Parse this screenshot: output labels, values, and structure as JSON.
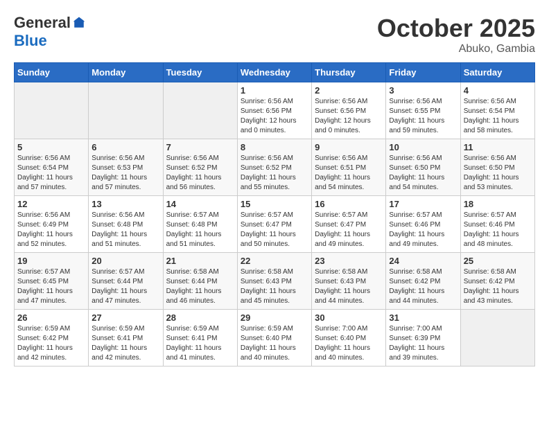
{
  "logo": {
    "general": "General",
    "blue": "Blue"
  },
  "title": "October 2025",
  "location": "Abuko, Gambia",
  "days_header": [
    "Sunday",
    "Monday",
    "Tuesday",
    "Wednesday",
    "Thursday",
    "Friday",
    "Saturday"
  ],
  "weeks": [
    [
      {
        "day": "",
        "info": ""
      },
      {
        "day": "",
        "info": ""
      },
      {
        "day": "",
        "info": ""
      },
      {
        "day": "1",
        "info": "Sunrise: 6:56 AM\nSunset: 6:56 PM\nDaylight: 12 hours\nand 0 minutes."
      },
      {
        "day": "2",
        "info": "Sunrise: 6:56 AM\nSunset: 6:56 PM\nDaylight: 12 hours\nand 0 minutes."
      },
      {
        "day": "3",
        "info": "Sunrise: 6:56 AM\nSunset: 6:55 PM\nDaylight: 11 hours\nand 59 minutes."
      },
      {
        "day": "4",
        "info": "Sunrise: 6:56 AM\nSunset: 6:54 PM\nDaylight: 11 hours\nand 58 minutes."
      }
    ],
    [
      {
        "day": "5",
        "info": "Sunrise: 6:56 AM\nSunset: 6:54 PM\nDaylight: 11 hours\nand 57 minutes."
      },
      {
        "day": "6",
        "info": "Sunrise: 6:56 AM\nSunset: 6:53 PM\nDaylight: 11 hours\nand 57 minutes."
      },
      {
        "day": "7",
        "info": "Sunrise: 6:56 AM\nSunset: 6:52 PM\nDaylight: 11 hours\nand 56 minutes."
      },
      {
        "day": "8",
        "info": "Sunrise: 6:56 AM\nSunset: 6:52 PM\nDaylight: 11 hours\nand 55 minutes."
      },
      {
        "day": "9",
        "info": "Sunrise: 6:56 AM\nSunset: 6:51 PM\nDaylight: 11 hours\nand 54 minutes."
      },
      {
        "day": "10",
        "info": "Sunrise: 6:56 AM\nSunset: 6:50 PM\nDaylight: 11 hours\nand 54 minutes."
      },
      {
        "day": "11",
        "info": "Sunrise: 6:56 AM\nSunset: 6:50 PM\nDaylight: 11 hours\nand 53 minutes."
      }
    ],
    [
      {
        "day": "12",
        "info": "Sunrise: 6:56 AM\nSunset: 6:49 PM\nDaylight: 11 hours\nand 52 minutes."
      },
      {
        "day": "13",
        "info": "Sunrise: 6:56 AM\nSunset: 6:48 PM\nDaylight: 11 hours\nand 51 minutes."
      },
      {
        "day": "14",
        "info": "Sunrise: 6:57 AM\nSunset: 6:48 PM\nDaylight: 11 hours\nand 51 minutes."
      },
      {
        "day": "15",
        "info": "Sunrise: 6:57 AM\nSunset: 6:47 PM\nDaylight: 11 hours\nand 50 minutes."
      },
      {
        "day": "16",
        "info": "Sunrise: 6:57 AM\nSunset: 6:47 PM\nDaylight: 11 hours\nand 49 minutes."
      },
      {
        "day": "17",
        "info": "Sunrise: 6:57 AM\nSunset: 6:46 PM\nDaylight: 11 hours\nand 49 minutes."
      },
      {
        "day": "18",
        "info": "Sunrise: 6:57 AM\nSunset: 6:46 PM\nDaylight: 11 hours\nand 48 minutes."
      }
    ],
    [
      {
        "day": "19",
        "info": "Sunrise: 6:57 AM\nSunset: 6:45 PM\nDaylight: 11 hours\nand 47 minutes."
      },
      {
        "day": "20",
        "info": "Sunrise: 6:57 AM\nSunset: 6:44 PM\nDaylight: 11 hours\nand 47 minutes."
      },
      {
        "day": "21",
        "info": "Sunrise: 6:58 AM\nSunset: 6:44 PM\nDaylight: 11 hours\nand 46 minutes."
      },
      {
        "day": "22",
        "info": "Sunrise: 6:58 AM\nSunset: 6:43 PM\nDaylight: 11 hours\nand 45 minutes."
      },
      {
        "day": "23",
        "info": "Sunrise: 6:58 AM\nSunset: 6:43 PM\nDaylight: 11 hours\nand 44 minutes."
      },
      {
        "day": "24",
        "info": "Sunrise: 6:58 AM\nSunset: 6:42 PM\nDaylight: 11 hours\nand 44 minutes."
      },
      {
        "day": "25",
        "info": "Sunrise: 6:58 AM\nSunset: 6:42 PM\nDaylight: 11 hours\nand 43 minutes."
      }
    ],
    [
      {
        "day": "26",
        "info": "Sunrise: 6:59 AM\nSunset: 6:42 PM\nDaylight: 11 hours\nand 42 minutes."
      },
      {
        "day": "27",
        "info": "Sunrise: 6:59 AM\nSunset: 6:41 PM\nDaylight: 11 hours\nand 42 minutes."
      },
      {
        "day": "28",
        "info": "Sunrise: 6:59 AM\nSunset: 6:41 PM\nDaylight: 11 hours\nand 41 minutes."
      },
      {
        "day": "29",
        "info": "Sunrise: 6:59 AM\nSunset: 6:40 PM\nDaylight: 11 hours\nand 40 minutes."
      },
      {
        "day": "30",
        "info": "Sunrise: 7:00 AM\nSunset: 6:40 PM\nDaylight: 11 hours\nand 40 minutes."
      },
      {
        "day": "31",
        "info": "Sunrise: 7:00 AM\nSunset: 6:39 PM\nDaylight: 11 hours\nand 39 minutes."
      },
      {
        "day": "",
        "info": ""
      }
    ]
  ]
}
